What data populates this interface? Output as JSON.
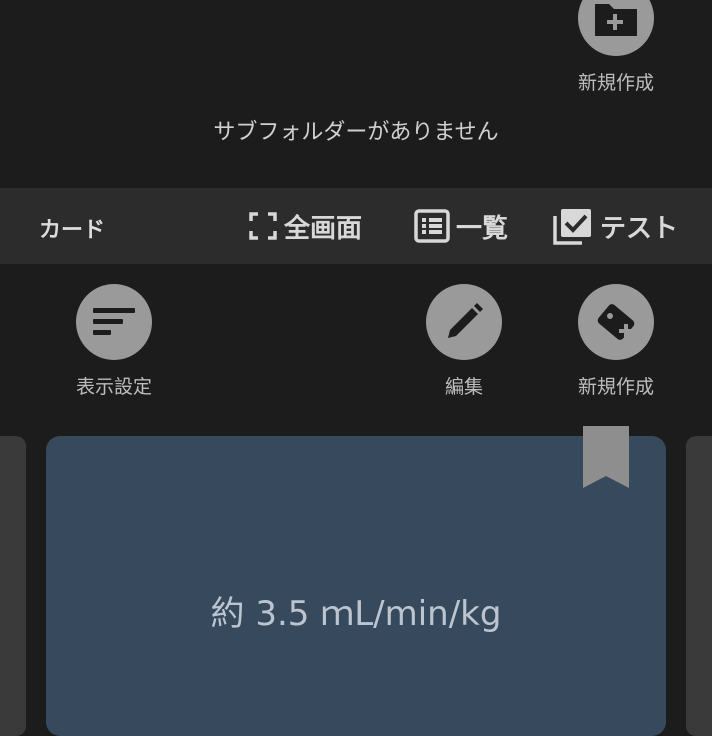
{
  "folder_new": {
    "label": "新規作成",
    "icon": "folder-plus-icon"
  },
  "subfolder_message": "サブフォルダーがありません",
  "toolbar": {
    "title": "カード",
    "fullscreen_label": "全画面",
    "list_label": "一覧",
    "test_label": "テスト"
  },
  "actions": {
    "display_settings": "表示設定",
    "edit": "編集",
    "new_card": "新規作成"
  },
  "card": {
    "text": "約 3.5 ｍL/min/kg",
    "bookmark_icon": "bookmark-icon"
  },
  "colors": {
    "background": "#1c1c1c",
    "toolbar": "#2c2c2c",
    "card": "#374a5d",
    "icon_circle": "#9a9a9a"
  }
}
